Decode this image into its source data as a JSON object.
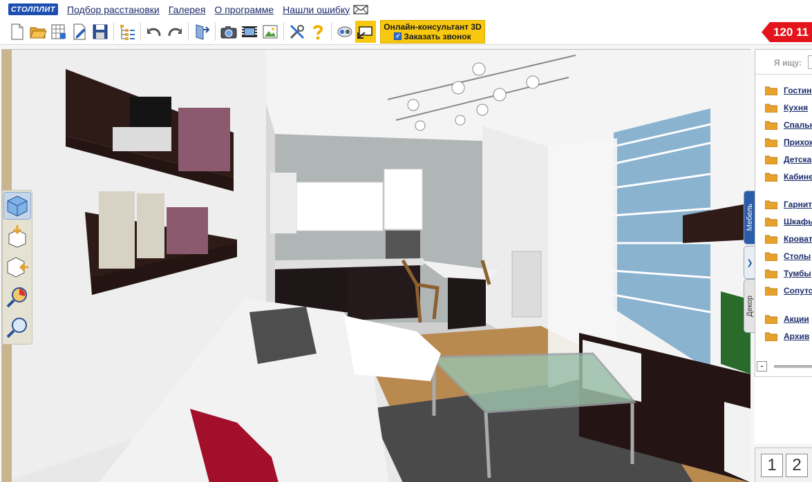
{
  "logo": {
    "text": "СТОЛПЛИТ"
  },
  "menu": [
    {
      "label": "Подбор расстановки"
    },
    {
      "label": "Галерея"
    },
    {
      "label": "О программе"
    },
    {
      "label": "Нашли ошибку"
    }
  ],
  "toolbar": {
    "icons": [
      "new-file-icon",
      "open-folder-icon",
      "floor-plan-icon",
      "edit-document-icon",
      "save-disk-icon",
      "tree-list-icon",
      "undo-icon",
      "redo-icon",
      "export-icon",
      "camera-icon",
      "video-icon",
      "image-icon",
      "tools-icon",
      "help-icon",
      "connect-icon",
      "screen-share-icon"
    ],
    "consultant": {
      "title": "Онлайн-консультант 3D",
      "subtitle": "Заказать звонок",
      "check_mark": "✓"
    },
    "phone": "120 11"
  },
  "view_tools": [
    "3d-view-icon",
    "camera-down-icon",
    "camera-side-icon",
    "zoom-color-icon",
    "zoom-icon"
  ],
  "side_tabs": {
    "furniture": "Мебель",
    "decor": "Декор",
    "arrow": "❯"
  },
  "catalog": {
    "search_label": "Я ищу:",
    "search_value": "",
    "items": [
      {
        "label": "Гостин"
      },
      {
        "label": "Кухня"
      },
      {
        "label": "Спальн"
      },
      {
        "label": "Прихож"
      },
      {
        "label": "Детска"
      },
      {
        "label": "Кабине"
      },
      {
        "label": "Гарнит"
      },
      {
        "label": "Шкафы"
      },
      {
        "label": "Кроват"
      },
      {
        "label": "Столы"
      },
      {
        "label": "Тумбы"
      },
      {
        "label": "Сопутс"
      },
      {
        "label": "Акции"
      },
      {
        "label": "Архив"
      }
    ],
    "zoom_minus": "-"
  },
  "pages": [
    {
      "label": "1"
    },
    {
      "label": "2"
    }
  ],
  "colors": {
    "accent": "#1b2b6a",
    "folder": "#e8a22b",
    "consultant": "#f7c80f",
    "phone": "#e3141b",
    "tab_active": "#2a5caa"
  }
}
